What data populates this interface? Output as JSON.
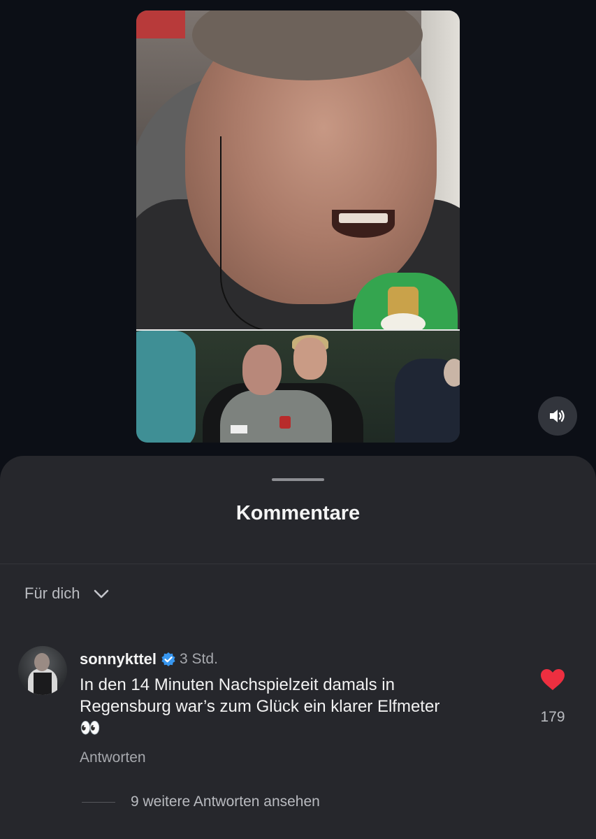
{
  "media": {
    "top_image": "interview-photo",
    "bottom_image": "celebration-photo"
  },
  "sound_button": {
    "icon": "speaker-icon"
  },
  "sheet": {
    "title": "Kommentare",
    "filter": {
      "label": "Für dich",
      "icon": "chevron-down-icon"
    }
  },
  "comment": {
    "username": "sonnykttel",
    "verified": true,
    "time": "3 Std.",
    "text_line1": "In den 14 Minuten Nachspielzeit damals in",
    "text_line2": "Regensburg war’s zum Glück ein klarer Elfmeter",
    "emoji": "👀",
    "reply_label": "Antworten",
    "likes": "179",
    "like_color": "#ed2f40"
  },
  "more_replies": {
    "label": "9 weitere Antworten ansehen"
  },
  "colors": {
    "background": "#0c0f16",
    "sheet": "#26272c",
    "verified_blue": "#3897f0"
  }
}
